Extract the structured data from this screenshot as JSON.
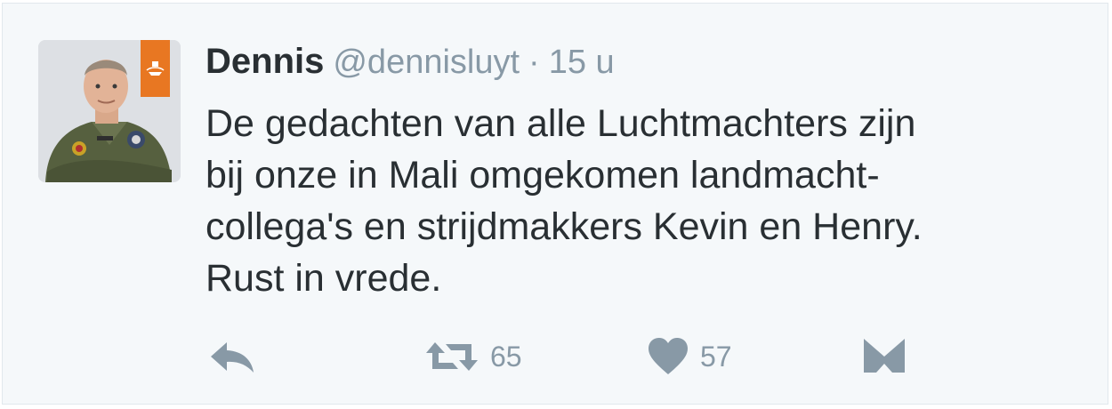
{
  "tweet": {
    "display_name": "Dennis",
    "handle": "@dennisluyt",
    "separator": "·",
    "time": "15 u",
    "text": "De gedachten van alle Luchtmachters zijn\nbij onze in Mali omgekomen landmacht-\ncollega's en strijdmakkers Kevin en Henry.\nRust in vrede."
  },
  "actions": {
    "reply_icon": "reply-icon",
    "retweet_icon": "retweet-icon",
    "retweet_count": "65",
    "like_icon": "heart-icon",
    "like_count": "57",
    "dm_icon": "direct-message-icon"
  },
  "colors": {
    "card_background": "#f5f8fa",
    "text_primary": "#292f33",
    "text_secondary": "#8899a6",
    "avatar_badge": "#e87722"
  }
}
